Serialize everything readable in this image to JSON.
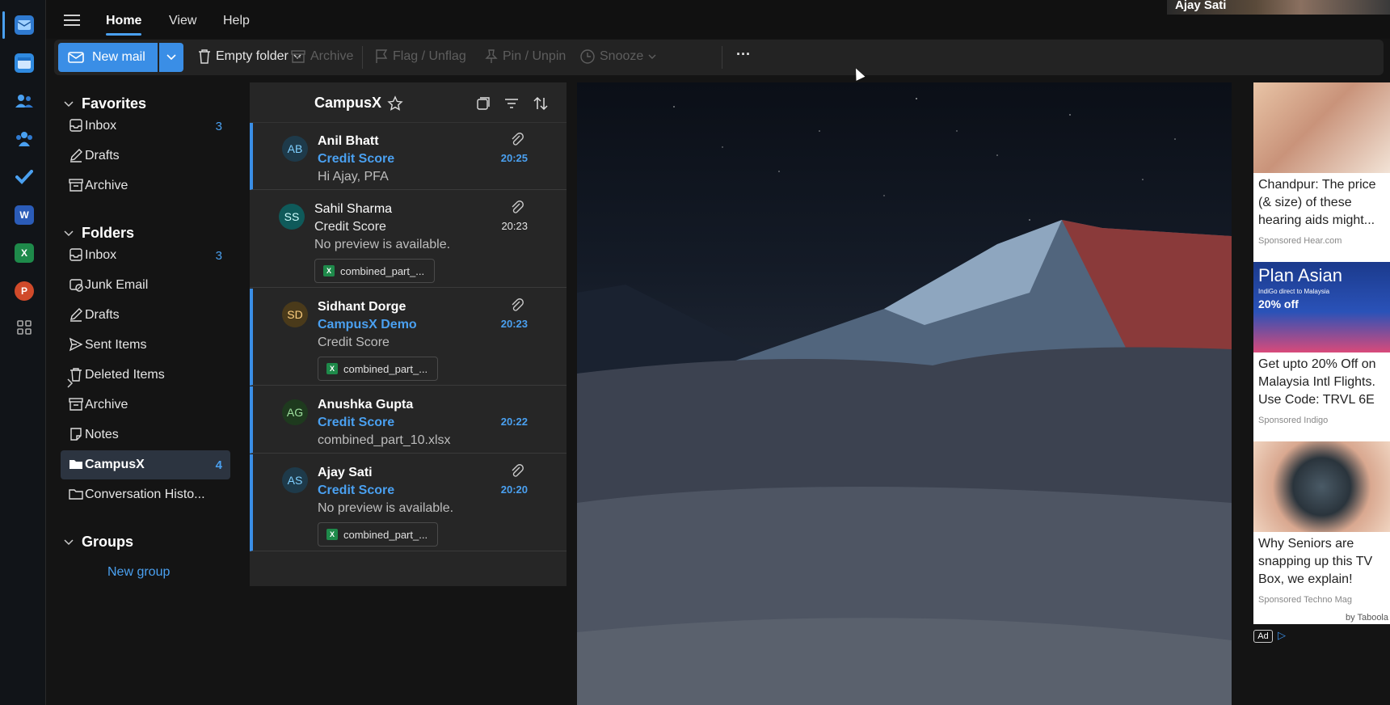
{
  "top_nav": {
    "tabs": [
      "Home",
      "View",
      "Help"
    ],
    "user_name": "Ajay Sati"
  },
  "ribbon": {
    "new_mail": "New mail",
    "empty_folder": "Empty folder",
    "archive": "Archive",
    "flag": "Flag / Unflag",
    "pin": "Pin / Unpin",
    "snooze": "Snooze",
    "more": "···"
  },
  "nav": {
    "favorites_label": "Favorites",
    "favorites": [
      {
        "label": "Inbox",
        "count": "3",
        "icon": "inbox-icon"
      },
      {
        "label": "Drafts",
        "count": "",
        "icon": "drafts-icon"
      },
      {
        "label": "Archive",
        "count": "",
        "icon": "archive-icon"
      }
    ],
    "folders_label": "Folders",
    "folders": [
      {
        "label": "Inbox",
        "count": "3",
        "icon": "inbox-icon"
      },
      {
        "label": "Junk Email",
        "count": "",
        "icon": "junk-icon"
      },
      {
        "label": "Drafts",
        "count": "",
        "icon": "drafts-icon"
      },
      {
        "label": "Sent Items",
        "count": "",
        "icon": "send-icon"
      },
      {
        "label": "Deleted Items",
        "count": "",
        "icon": "trash-icon"
      },
      {
        "label": "Archive",
        "count": "",
        "icon": "archive-icon"
      },
      {
        "label": "Notes",
        "count": "",
        "icon": "notes-icon"
      },
      {
        "label": "CampusX",
        "count": "4",
        "icon": "folder-icon"
      },
      {
        "label": "Conversation Histo...",
        "count": "",
        "icon": "folder-icon"
      }
    ],
    "groups_label": "Groups",
    "new_group": "New group"
  },
  "message_list": {
    "title": "CampusX",
    "messages": [
      {
        "initials": "AB",
        "sender": "Anil Bhatt",
        "subject": "Credit Score",
        "preview": "Hi Ajay, PFA",
        "time": "20:25",
        "unread": true,
        "attachment": ""
      },
      {
        "initials": "SS",
        "sender": "Sahil Sharma",
        "subject": "Credit Score",
        "preview": "No preview is available.",
        "time": "20:23",
        "unread": false,
        "attachment": "combined_part_..."
      },
      {
        "initials": "SD",
        "sender": "Sidhant Dorge",
        "subject": "CampusX Demo",
        "preview": "Credit Score",
        "time": "20:23",
        "unread": true,
        "attachment": "combined_part_..."
      },
      {
        "initials": "AG",
        "sender": "Anushka Gupta",
        "subject": "Credit Score",
        "preview": "combined_part_10.xlsx",
        "time": "20:22",
        "unread": true,
        "attachment": ""
      },
      {
        "initials": "AS",
        "sender": "Ajay Sati",
        "subject": "Credit Score",
        "preview": "No preview is available.",
        "time": "20:20",
        "unread": true,
        "attachment": "combined_part_..."
      }
    ]
  },
  "ads": {
    "items": [
      {
        "title": "Chandpur: The price (& size) of these hearing aids might...",
        "sponsor": "Sponsored",
        "source": "Hear.com"
      },
      {
        "title": "Get upto 20% Off on Malaysia Intl Flights. Use Code: TRVL 6E",
        "sponsor": "Sponsored",
        "source": "Indigo",
        "banner_title": "Plan Asian",
        "banner_sub": "IndiGo direct to Malaysia",
        "banner_deal": "20% off"
      },
      {
        "title": "Why Seniors are snapping up this TV Box, we explain!",
        "sponsor": "Sponsored",
        "source": "Techno Mag"
      }
    ],
    "by": "by Taboola",
    "ad_badge": "Ad"
  }
}
